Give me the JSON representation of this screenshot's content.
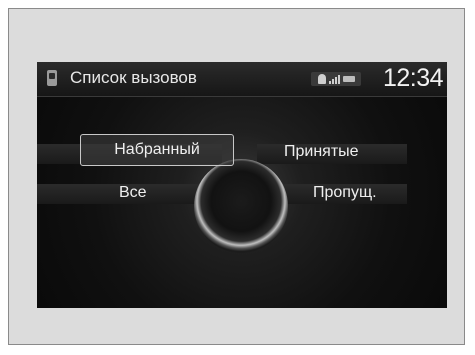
{
  "header": {
    "title": "Список вызовов",
    "clock": "12:34"
  },
  "menu": {
    "items": [
      {
        "label": "Набранный",
        "selected": true
      },
      {
        "label": "Принятые",
        "selected": false
      },
      {
        "label": "Все",
        "selected": false
      },
      {
        "label": "Пропущ.",
        "selected": false
      }
    ]
  },
  "colors": {
    "screen_bg": "#0b0b0b",
    "text": "#efefef",
    "frame_bg": "#dcdcdc"
  },
  "icons": [
    "phone-icon",
    "bluetooth-icon",
    "signal-icon",
    "battery-icon"
  ]
}
